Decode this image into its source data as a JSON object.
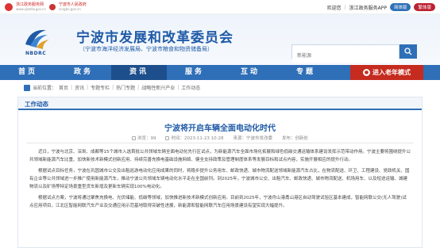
{
  "topbar": {
    "gov_name": "浙江政务服务网",
    "gov_domain": "www.zjzwfw.gov.cn",
    "people_gov": "宁波市人民政府",
    "people_domain": "ningbo.gov.cn",
    "welcome": "欢迎您",
    "app_link": "浙江政务服务APP",
    "simplified": "简体版",
    "traditional": "繁体版"
  },
  "header": {
    "logo_text": "NBDRC",
    "title": "宁波市发展和改革委员会",
    "subtitle": "（宁波市海洋经济发展局、宁波市粮食和物资储备局）",
    "search_placeholder": "新能源"
  },
  "nav": {
    "items": [
      "首页",
      "政务",
      "资讯",
      "服务",
      "互动",
      "专题"
    ],
    "active_index": 2,
    "elder_mode": "进入老年模式"
  },
  "breadcrumb": {
    "label": "当前位置：",
    "items": [
      "首页",
      "资讯",
      "专题专栏",
      "热门专题",
      "战略性新兴产业",
      "工作动态"
    ]
  },
  "panel": {
    "heading": "工作动态"
  },
  "article": {
    "title": "宁波将开启车辆全面电动化时代",
    "views": "浏览：99",
    "time": "时间：2023-11-23 10:28",
    "source": "来源：宁波市发改委",
    "author": "发布：创新处",
    "paragraphs": [
      "近日，宁波与北京、深圳、成都等15个城市入选首批公共领域车辆全面电动化先行区试点，为新能源汽车全面市场化拓展和绿色低碳交通运输体系建设发挥示范带动作用。宁波主要将围绕提升公共领域新能源汽车比重、加快新技术新模式创新应用、持续完善充换电基础设施网络、健全支持政策及管理制度体系等发展目标和试点内容，实施开展相应的提升行动。",
      "根据试点目标任务，宁波在巩固城市公交及出租巡游电动化应用成果的同时，将稳步提升公务用车、邮政快递、城市物流配送领域新能源汽车占比，在物流配送、环卫、工程建设、党政机关、国有企业等公共领域进一步推广使用新能源汽车，推动宁波公共领域车辆电动化水平走在全国前列。到2025年，宁波城市公交、出租汽车、邮政快递、城市物流配送、机场用车、以及短途运输、城建物流以及矿场等特定场景重型货车新增及更新车辆实现100%电动化。",
      "根据试点方案，宁波将通过聚焦充换电、光伏储能、低碳等领域，加快推进新技术新模式创新应用。目前到2025年，宁波舟山港甬山港区自动驾驶试验区基本建成，智能网联公交(无人驾驶)试点应用项目，江北区智能网联汽车产业及交通应用示范基地取得突破性进展，新能源和智能网联汽车应用场景建设有望实现大幅提升。"
    ]
  }
}
